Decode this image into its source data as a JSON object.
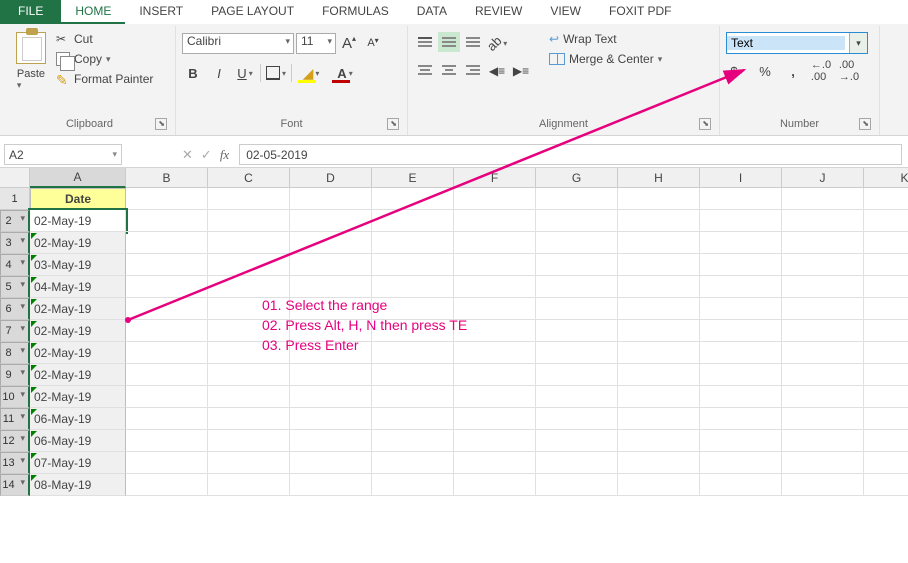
{
  "tabs": {
    "file": "FILE",
    "home": "HOME",
    "insert": "INSERT",
    "pagelayout": "PAGE LAYOUT",
    "formulas": "FORMULAS",
    "data": "DATA",
    "review": "REVIEW",
    "view": "VIEW",
    "foxit": "FOXIT PDF"
  },
  "clipboard": {
    "paste": "Paste",
    "cut": "Cut",
    "copy": "Copy",
    "format_painter": "Format Painter",
    "label": "Clipboard"
  },
  "font": {
    "name": "Calibri",
    "size": "11",
    "grow": "A",
    "shrink": "A",
    "bold": "B",
    "italic": "I",
    "underline": "U",
    "fontcolor": "A",
    "label": "Font"
  },
  "alignment": {
    "wrap": "Wrap Text",
    "merge": "Merge & Center",
    "label": "Alignment"
  },
  "number": {
    "format_value": "Text",
    "currency": "$",
    "percent": "%",
    "comma": ",",
    "inc_dec": ".0\n.00",
    "dec_dec": ".00\n.0",
    "label": "Number"
  },
  "fx": {
    "namebox": "A2",
    "formula": "02-05-2019"
  },
  "columns": [
    "A",
    "B",
    "C",
    "D",
    "E",
    "F",
    "G",
    "H",
    "I",
    "J",
    "K"
  ],
  "rows": [
    {
      "n": "1",
      "a": "Date",
      "hdr": true
    },
    {
      "n": "2",
      "a": "02-May-19",
      "active": true
    },
    {
      "n": "3",
      "a": "02-May-19",
      "sel": true,
      "tri": true
    },
    {
      "n": "4",
      "a": "03-May-19",
      "sel": true,
      "tri": true
    },
    {
      "n": "5",
      "a": "04-May-19",
      "sel": true,
      "tri": true
    },
    {
      "n": "6",
      "a": "02-May-19",
      "sel": true,
      "tri": true
    },
    {
      "n": "7",
      "a": "02-May-19",
      "sel": true,
      "tri": true
    },
    {
      "n": "8",
      "a": "02-May-19",
      "sel": true,
      "tri": true
    },
    {
      "n": "9",
      "a": "02-May-19",
      "sel": true,
      "tri": true
    },
    {
      "n": "10",
      "a": "02-May-19",
      "sel": true,
      "tri": true
    },
    {
      "n": "11",
      "a": "06-May-19",
      "sel": true,
      "tri": true
    },
    {
      "n": "12",
      "a": "06-May-19",
      "sel": true,
      "tri": true
    },
    {
      "n": "13",
      "a": "07-May-19",
      "sel": true,
      "tri": true
    },
    {
      "n": "14",
      "a": "08-May-19",
      "sel": true,
      "tri": true
    }
  ],
  "annot": {
    "l1": "01. Select the range",
    "l2": "02. Press Alt, H, N then press TE",
    "l3": "03. Press Enter"
  }
}
